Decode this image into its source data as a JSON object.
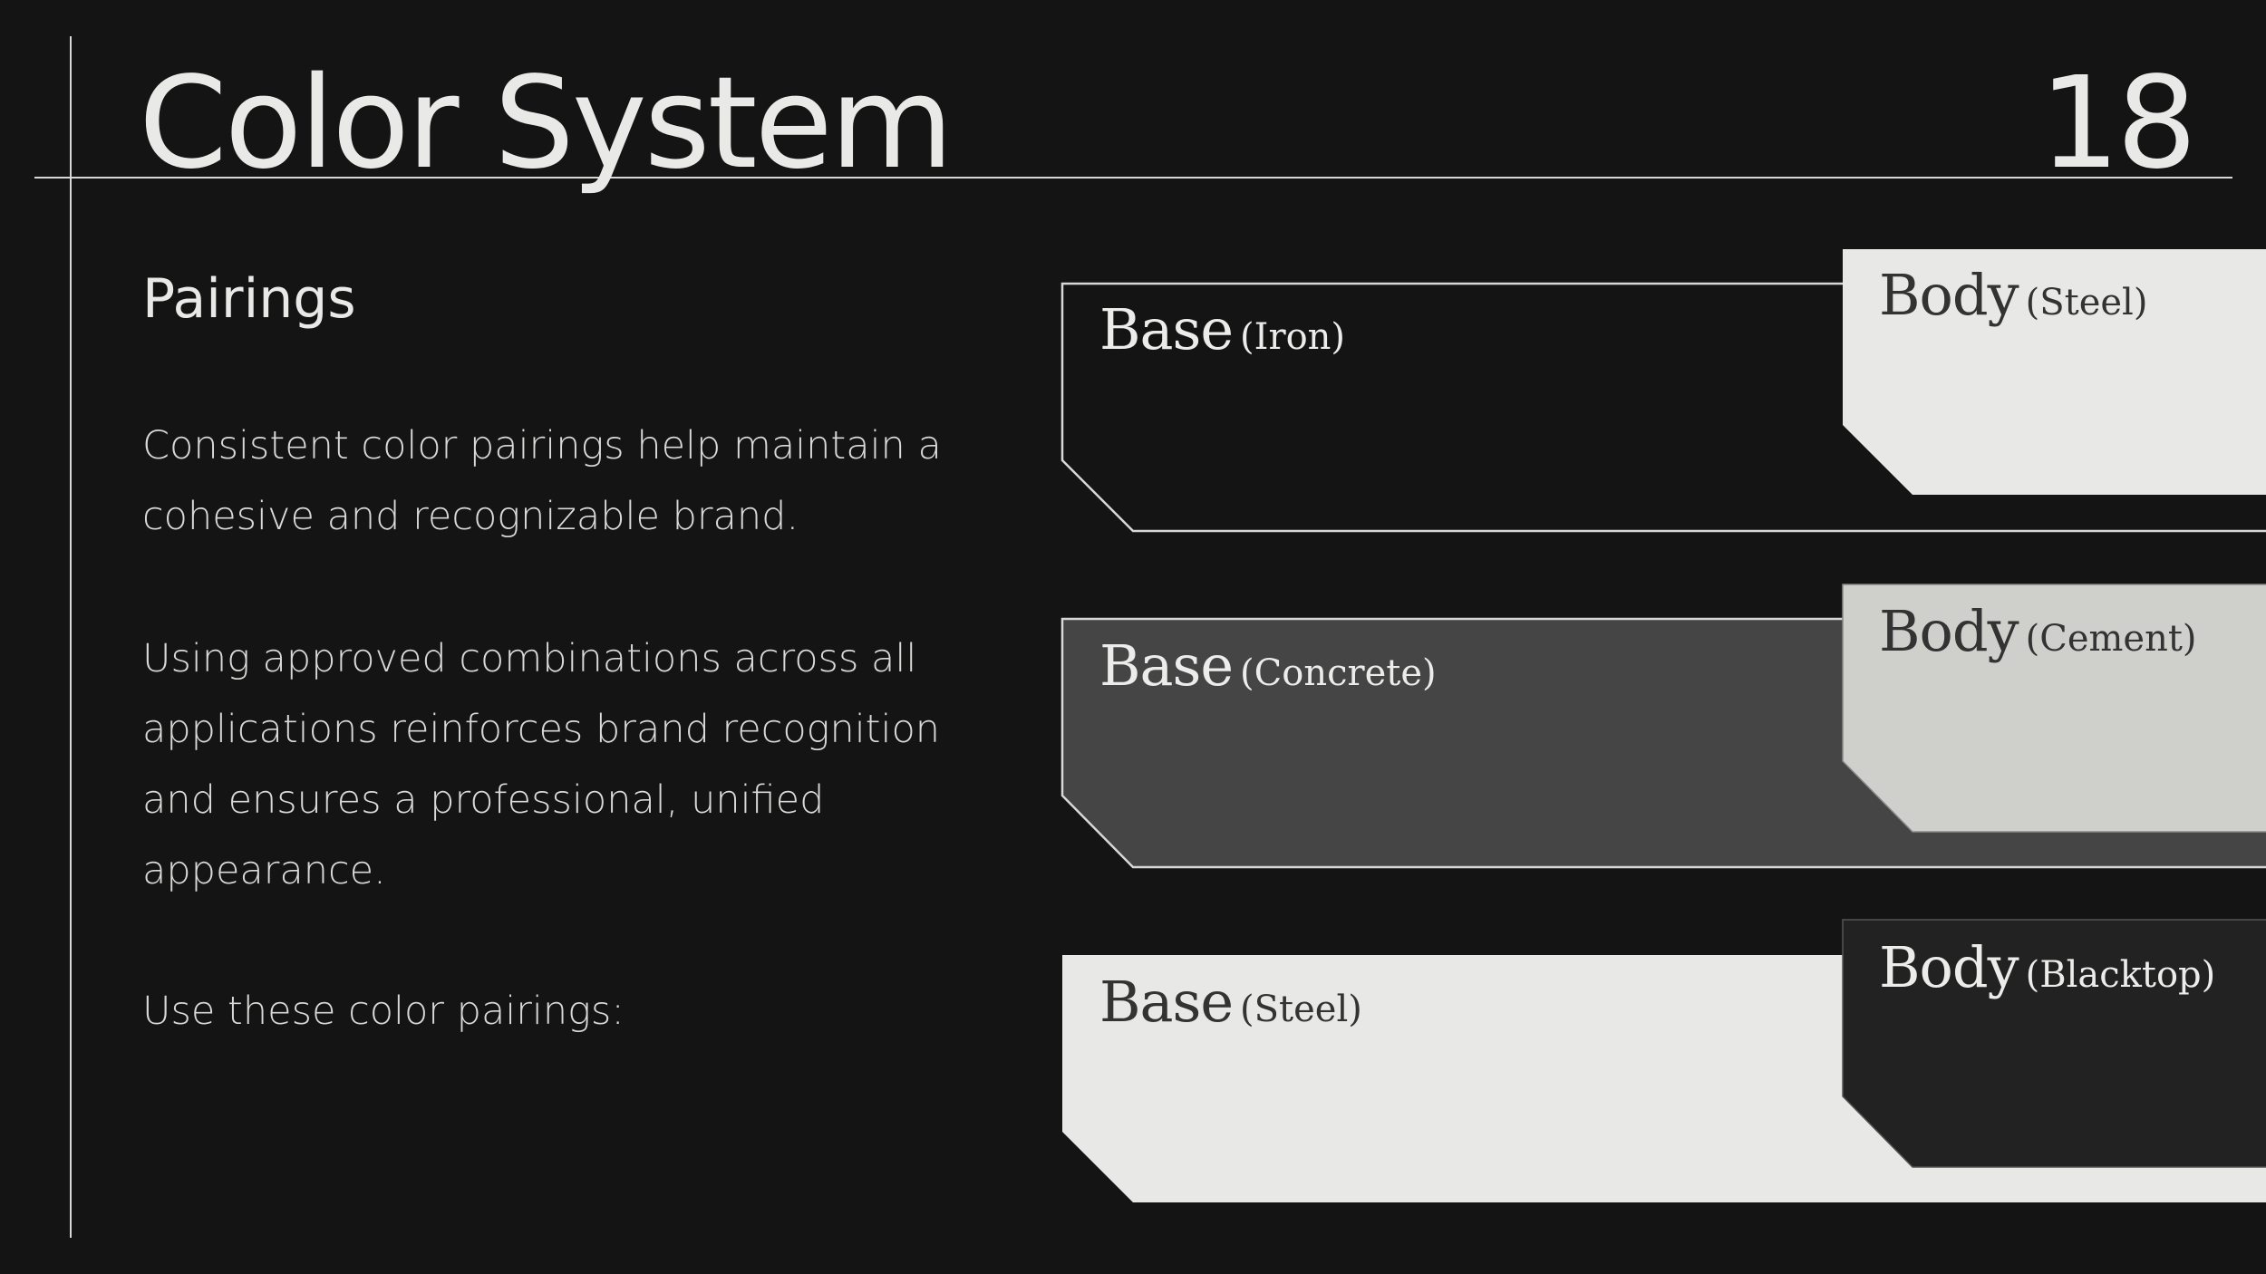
{
  "slide": {
    "title": "Color System",
    "page_number": "18",
    "subheading": "Pairings",
    "paragraphs": [
      "Consistent color pairings help maintain a cohesive and recognizable brand.",
      "Using approved combinations across all applications reinforces brand recognition and ensures a professional, unified appearance.",
      "Use these color pairings:"
    ]
  },
  "pairings": [
    {
      "base_label": "Base",
      "base_name": "(Iron)",
      "base_color": "#141414",
      "body_label": "Body",
      "body_name": "(Steel)",
      "body_color": "#e8e8e6"
    },
    {
      "base_label": "Base",
      "base_name": "(Concrete)",
      "base_color": "#454545",
      "body_label": "Body",
      "body_name": "(Cement)",
      "body_color": "#cfd0cb"
    },
    {
      "base_label": "Base",
      "base_name": "(Steel)",
      "base_color": "#e8e8e6",
      "body_label": "Body",
      "body_name": "(Blacktop)",
      "body_color": "#222222"
    }
  ],
  "colors": {
    "background": "#141414",
    "text": "#e9e9e7",
    "rule": "#d8d8d6"
  }
}
